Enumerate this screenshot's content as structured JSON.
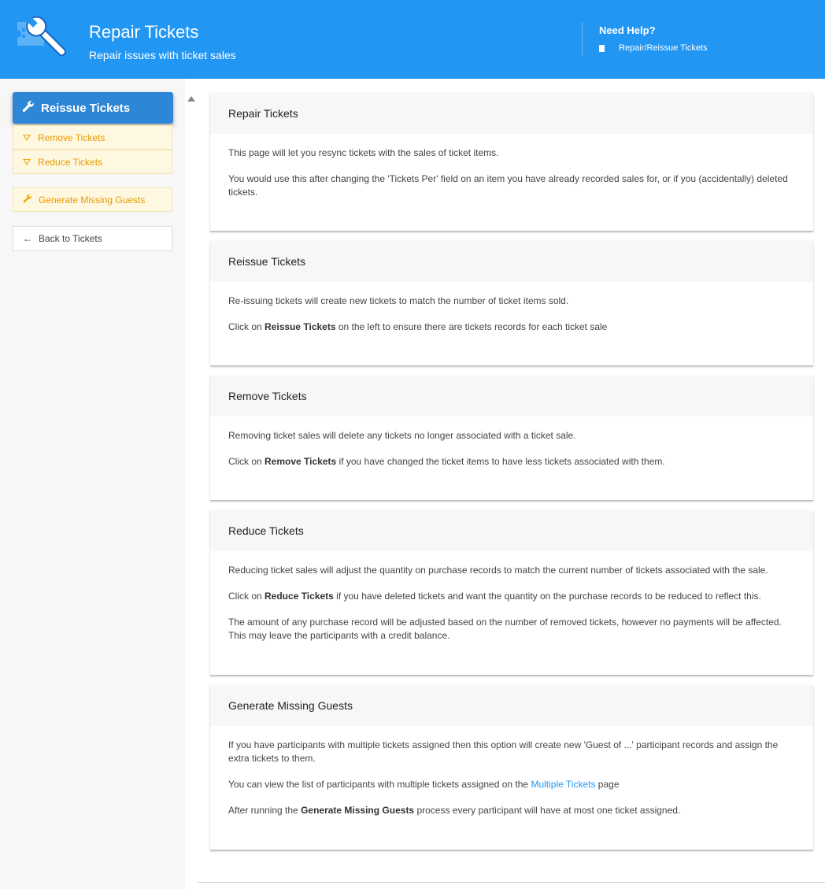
{
  "header": {
    "title": "Repair Tickets",
    "subtitle": "Repair issues with ticket sales",
    "help_title": "Need Help?",
    "help_link": "Repair/Reissue Tickets",
    "logo_icon": "ticket-wrench-icon",
    "background": "#2196f3"
  },
  "sidebar": {
    "primary": {
      "label": "Reissue Tickets",
      "icon": "wrench-icon",
      "color": "#2e86d6"
    },
    "subitems": [
      {
        "label": "Remove Tickets",
        "icon": "triangle-down-icon"
      },
      {
        "label": "Reduce Tickets",
        "icon": "triangle-down-icon"
      }
    ],
    "generate": {
      "label": "Generate Missing Guests",
      "icon": "wrench-icon"
    },
    "back": {
      "label": "Back to Tickets",
      "icon": "arrow-left-icon"
    }
  },
  "cards": {
    "repair": {
      "title": "Repair Tickets",
      "p1": "This page will let you resync tickets with the sales of ticket items.",
      "p2": "You would use this after changing the 'Tickets Per' field on an item you have already recorded sales for, or if you (accidentally) deleted tickets."
    },
    "reissue": {
      "title": "Reissue Tickets",
      "p1": "Re-issuing tickets will create new tickets to match the number of ticket items sold.",
      "p2_pre": "Click on ",
      "p2_bold": "Reissue Tickets",
      "p2_post": " on the left to ensure there are tickets records for each ticket sale"
    },
    "remove": {
      "title": "Remove Tickets",
      "p1": "Removing ticket sales will delete any tickets no longer associated with a ticket sale.",
      "p2_pre": "Click on ",
      "p2_bold": "Remove Tickets",
      "p2_post": " if you have changed the ticket items to have less tickets associated with them."
    },
    "reduce": {
      "title": "Reduce Tickets",
      "p1": "Reducing ticket sales will adjust the quantity on purchase records to match the current number of tickets associated with the sale.",
      "p2_pre": "Click on ",
      "p2_bold": "Reduce Tickets",
      "p2_post": " if you have deleted tickets and want the quantity on the purchase records to be reduced to reflect this.",
      "p3": "The amount of any purchase record will be adjusted based on the number of removed tickets, however no payments will be affected. This may leave the participants with a credit balance."
    },
    "generate": {
      "title": "Generate Missing Guests",
      "p1": "If you have participants with multiple tickets assigned then this option will create new 'Guest of ...' participant records and assign the extra tickets to them.",
      "p2_pre": "You can view the list of participants with multiple tickets assigned on the ",
      "p2_link": "Multiple Tickets",
      "p2_post": " page",
      "p3_pre": "After running the ",
      "p3_bold": "Generate Missing Guests",
      "p3_post": " process every participant will have at most one ticket assigned."
    }
  }
}
